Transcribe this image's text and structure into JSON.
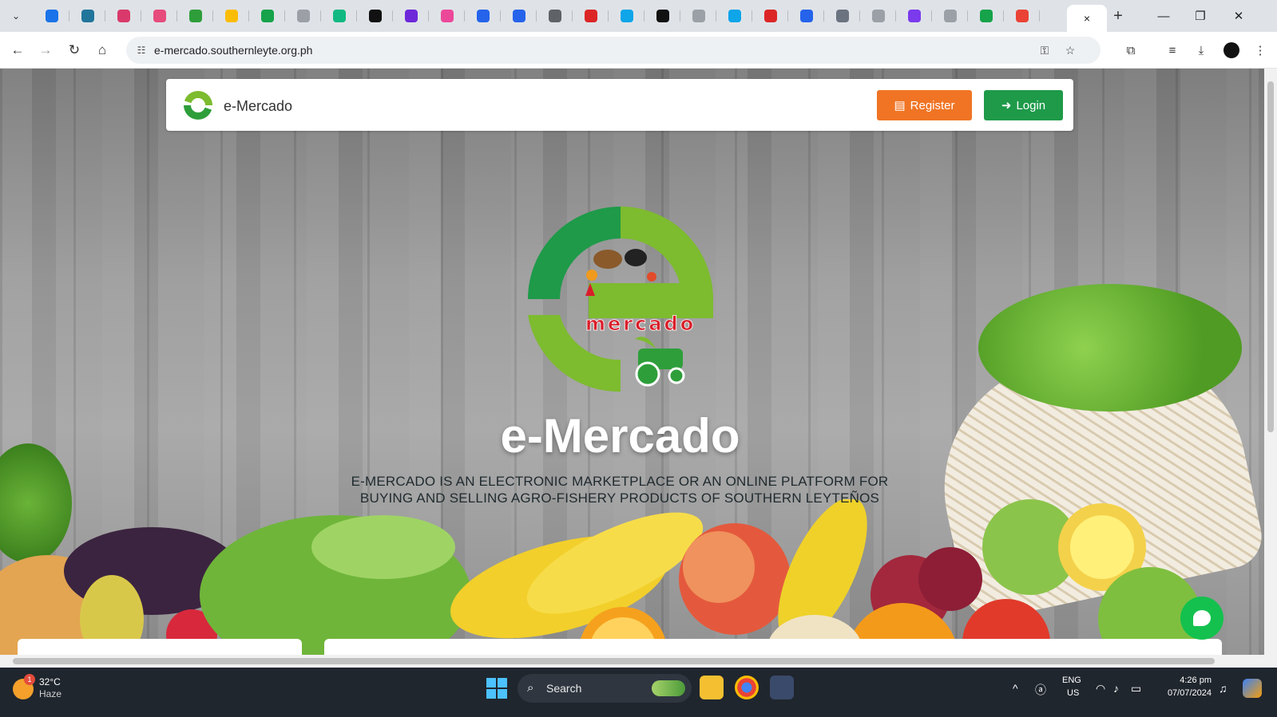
{
  "browser": {
    "tab_favicon_colors": [
      "#1a73e8",
      "#21759b",
      "#d93a6b",
      "#e64b7c",
      "#2e9e3a",
      "#fbbc04",
      "#16a34a",
      "#9aa0a6",
      "#10b981",
      "#111111",
      "#6d28d9",
      "#ec4899",
      "#2563eb",
      "#2563eb",
      "#5f6368",
      "#dc2626",
      "#0ea5e9",
      "#111111",
      "#9aa0a6",
      "#0ea5e9",
      "#dc2626",
      "#2563eb",
      "#6b7280",
      "#9aa0a6",
      "#7c3aed",
      "#9aa0a6",
      "#16a34a",
      "#ea4335"
    ],
    "active_tab_close": "×",
    "new_tab": "+",
    "window": {
      "minimize": "—",
      "restore": "❐",
      "close": "✕"
    },
    "address": "e-mercado.southernleyte.org.ph"
  },
  "page": {
    "nav": {
      "brand": "e-Mercado",
      "register_label": "Register",
      "login_label": "Login"
    },
    "hero": {
      "title": "e-Mercado",
      "subtitle": "E-MERCADO IS AN ELECTRONIC MARKETPLACE OR AN ONLINE PLATFORM FOR BUYING AND SELLING AGRO-FISHERY PRODUCTS OF SOUTHERN LEYTEÑOS",
      "logo_text": "mercado"
    },
    "colors": {
      "register": "#f07424",
      "login": "#1e9a49",
      "logo_dark": "#1e9a49",
      "logo_light": "#7dbb2f",
      "logo_text": "#d91e2a",
      "chat": "#14c14e"
    }
  },
  "taskbar": {
    "weather_badge": "1",
    "temperature": "32°C",
    "condition": "Haze",
    "search_label": "Search",
    "lang_line1": "ENG",
    "lang_line2": "US",
    "time": "4:26 pm",
    "date": "07/07/2024"
  }
}
